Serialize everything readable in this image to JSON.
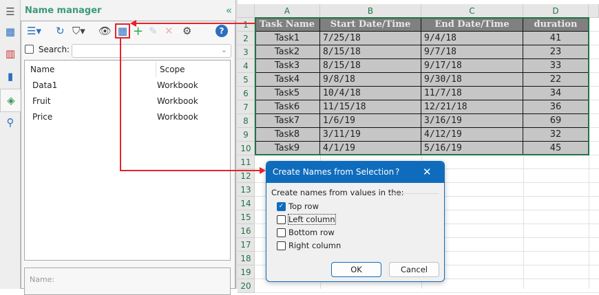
{
  "panel": {
    "title": "Name manager",
    "search_label": "Search:",
    "search_value": "",
    "columns": [
      "Name",
      "Scope"
    ],
    "rows": [
      {
        "name": "Data1",
        "scope": "Workbook"
      },
      {
        "name": "Fruit",
        "scope": "Workbook"
      },
      {
        "name": "Price",
        "scope": "Workbook"
      }
    ],
    "name_field_label": "Name:"
  },
  "sheet": {
    "columns": [
      "A",
      "B",
      "C",
      "D"
    ],
    "row_numbers": [
      "1",
      "2",
      "3",
      "4",
      "5",
      "6",
      "7",
      "8",
      "9",
      "10",
      "11",
      "12",
      "13",
      "14",
      "15",
      "16",
      "17",
      "18",
      "19",
      "20"
    ],
    "headers": [
      "Task Name",
      "Start Date/Time",
      "End Date/Time",
      "duration"
    ],
    "rows": [
      [
        "Task1",
        "7/25/18",
        "9/4/18",
        "41"
      ],
      [
        "Task2",
        "8/15/18",
        "9/7/18",
        "23"
      ],
      [
        "Task3",
        "8/15/18",
        "9/17/18",
        "33"
      ],
      [
        "Task4",
        "9/8/18",
        "9/30/18",
        "22"
      ],
      [
        "Task5",
        "10/4/18",
        "11/7/18",
        "34"
      ],
      [
        "Task6",
        "11/15/18",
        "12/21/18",
        "36"
      ],
      [
        "Task7",
        "1/6/19",
        "3/16/19",
        "69"
      ],
      [
        "Task8",
        "3/11/19",
        "4/12/19",
        "32"
      ],
      [
        "Task9",
        "4/1/19",
        "5/16/19",
        "45"
      ]
    ]
  },
  "dialog": {
    "title": "Create Names from Selection",
    "help": "?",
    "close": "✕",
    "prompt": "Create names from values in the:",
    "options": [
      {
        "label": "Top row",
        "checked": true
      },
      {
        "label": "Left column",
        "checked": false
      },
      {
        "label": "Bottom row",
        "checked": false
      },
      {
        "label": "Right column",
        "checked": false
      }
    ],
    "ok": "OK",
    "cancel": "Cancel"
  },
  "colors": {
    "accent": "#0f6cbd",
    "excel_green": "#217346",
    "annotation_red": "#e8202a",
    "title_green": "#3a9a7a"
  }
}
